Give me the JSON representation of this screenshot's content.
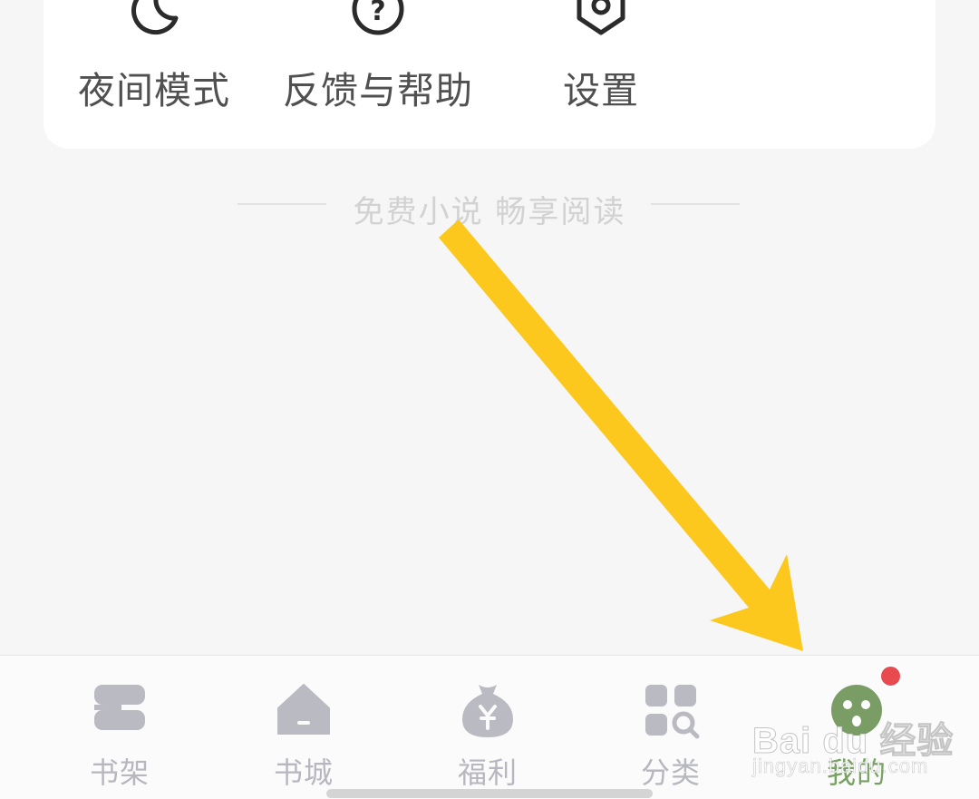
{
  "tools": [
    {
      "label": "夜间模式",
      "icon": "moon-icon"
    },
    {
      "label": "反馈与帮助",
      "icon": "question-circle-icon"
    },
    {
      "label": "设置",
      "icon": "gear-icon"
    }
  ],
  "slogan": "免费小说 畅享阅读",
  "tabs": [
    {
      "label": "书架",
      "icon": "bookshelf-icon",
      "active": false
    },
    {
      "label": "书城",
      "icon": "bookstore-house-icon",
      "active": false
    },
    {
      "label": "福利",
      "icon": "money-bag-icon",
      "active": false
    },
    {
      "label": "分类",
      "icon": "category-grid-icon",
      "active": false
    },
    {
      "label": "我的",
      "icon": "profile-avatar-icon",
      "active": true
    }
  ],
  "watermark": {
    "main": "Bai du 经验",
    "sub": "jingyan.baidu.com"
  },
  "colors": {
    "background": "#f6f6f6",
    "card": "#ffffff",
    "tab_inactive": "#b7b7bf",
    "tab_active": "#77a263",
    "badge": "#e84a4f",
    "arrow": "#fcc81e"
  }
}
